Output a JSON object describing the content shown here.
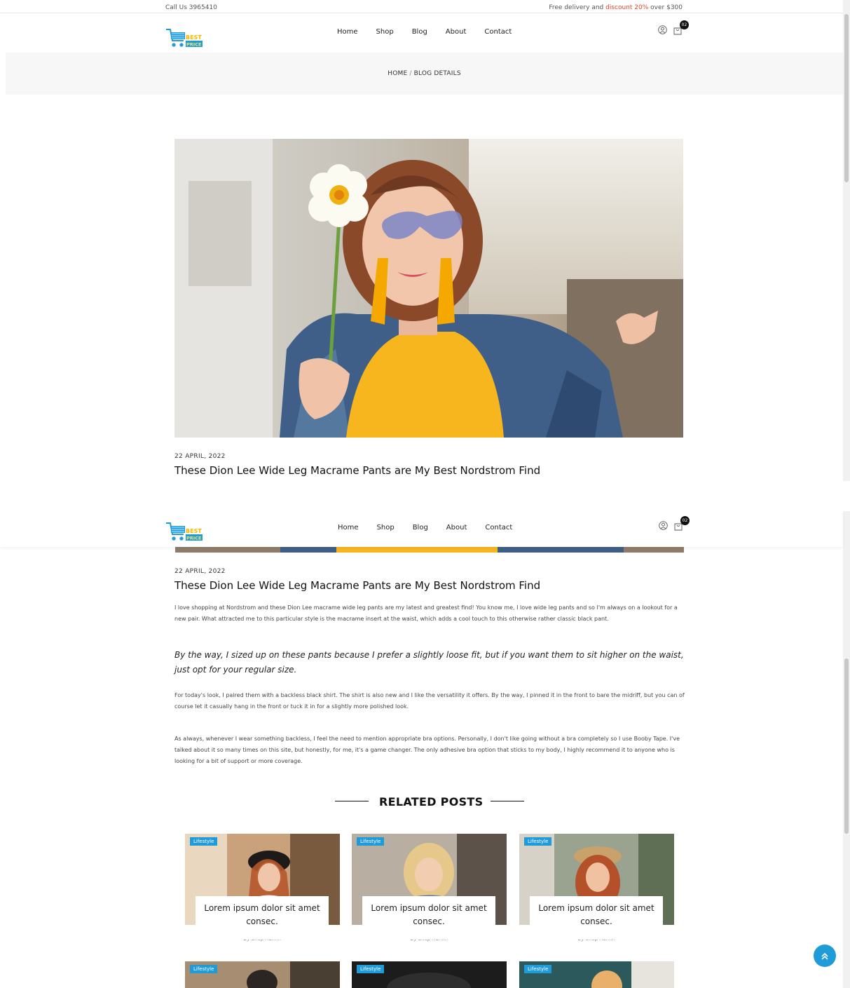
{
  "topbar": {
    "call": "Call Us 3965410",
    "promo_before": "Free delivery and ",
    "promo_highlight": "discount 20%",
    "promo_after": " over $300",
    "highlight_color": "#e8432f"
  },
  "logo": {
    "line1": "BEST",
    "line2": "PRICE"
  },
  "nav": {
    "items": [
      "Home",
      "Shop",
      "Blog",
      "About",
      "Contact"
    ]
  },
  "cart": {
    "count": "02"
  },
  "breadcrumb": {
    "home": "HOME",
    "separator": "/",
    "current": "BLOG DETAILS"
  },
  "post": {
    "date": "22 APRIL, 2022",
    "title": "These Dion Lee Wide Leg Macrame Pants are My Best Nordstrom Find",
    "paragraph1": "I love shopping at Nordstrom and these Dion Lee macrame wide leg pants are my latest and greatest find! You know me, I love wide leg pants and so I'm always on a lookout for a new pair. What attracted me to this particular style is the macrame insert at the waist, which adds a cool touch to this otherwise rather classic black pant.",
    "quote": "By the way, I sized up on these pants because I prefer a slightly loose fit, but if you want them to sit higher on the waist, just opt for your regular size.",
    "paragraph2": "For today's look, I paired them with a backless black shirt. The shirt is also new and I like the versatility it offers. By the way, I pinned it in the front to bare the midriff, but you can of course let it casually hang in the front or tuck it in for a slightly more polished look.",
    "paragraph3": "As always, whenever I wear something backless, I feel the need to mention appropriate bra options. Personally, I don't like going without a bra completely so I use Booby Tape. I've talked about it so many times on this site, but honestly, for me, it's a game changer. The only adhesive bra option that sticks to my body, I highly recommend it to anyone who is looking for a bit of support or more coverage."
  },
  "related": {
    "heading": "RELATED POSTS",
    "cards": [
      {
        "tag": "Lifestyle",
        "title": "Lorem ipsum dolor sit amet consec.",
        "byline": "By Shop Admin"
      },
      {
        "tag": "Lifestyle",
        "title": "Lorem ipsum dolor sit amet consec.",
        "byline": "By Shop Admin"
      },
      {
        "tag": "Lifestyle",
        "title": "Lorem ipsum dolor sit amet consec.",
        "byline": "By Shop Admin"
      },
      {
        "tag": "Lifestyle"
      },
      {
        "tag": "Lifestyle"
      },
      {
        "tag": "Lifestyle"
      }
    ]
  },
  "accent_color": "#1f9bd9"
}
